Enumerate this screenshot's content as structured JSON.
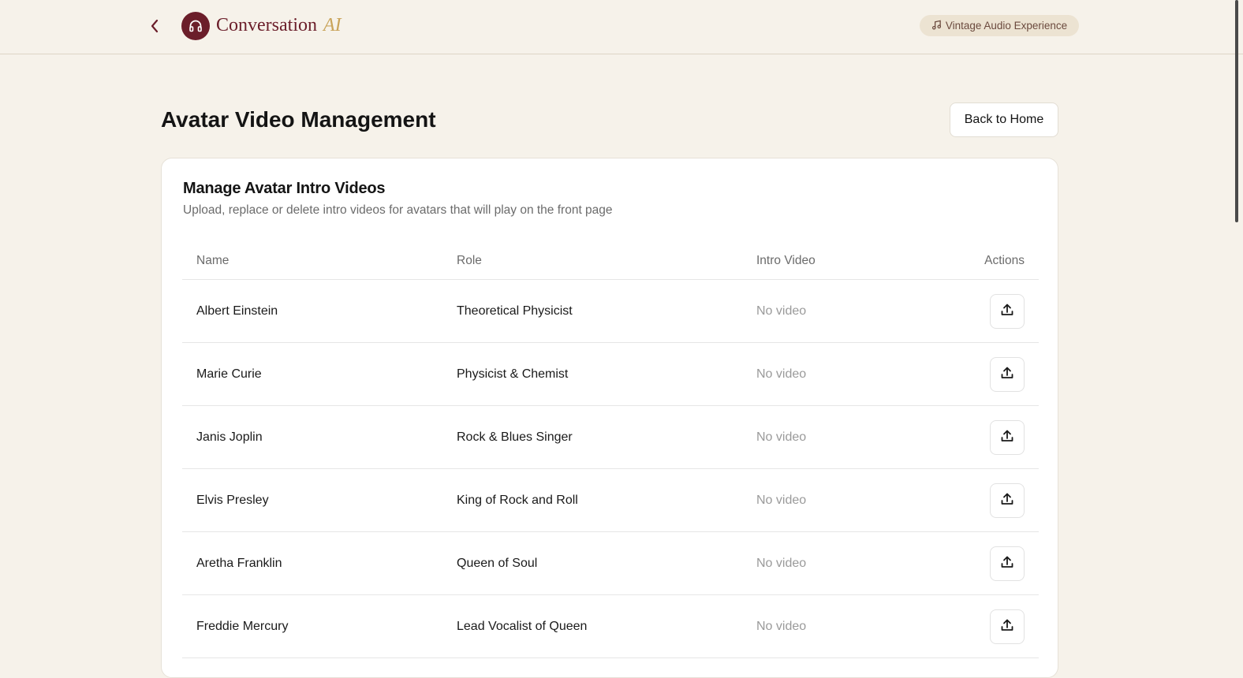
{
  "header": {
    "brand_name": "Conversation",
    "brand_ai": "AI",
    "badge_label": "Vintage Audio Experience"
  },
  "page": {
    "title": "Avatar Video Management",
    "back_home_label": "Back to Home"
  },
  "card": {
    "title": "Manage Avatar Intro Videos",
    "subtitle": "Upload, replace or delete intro videos for avatars that will play on the front page"
  },
  "table": {
    "columns": [
      "Name",
      "Role",
      "Intro Video",
      "Actions"
    ],
    "rows": [
      {
        "name": "Albert Einstein",
        "role": "Theoretical Physicist",
        "video": "No video"
      },
      {
        "name": "Marie Curie",
        "role": "Physicist & Chemist",
        "video": "No video"
      },
      {
        "name": "Janis Joplin",
        "role": "Rock & Blues Singer",
        "video": "No video"
      },
      {
        "name": "Elvis Presley",
        "role": "King of Rock and Roll",
        "video": "No video"
      },
      {
        "name": "Aretha Franklin",
        "role": "Queen of Soul",
        "video": "No video"
      },
      {
        "name": "Freddie Mercury",
        "role": "Lead Vocalist of Queen",
        "video": "No video"
      }
    ]
  },
  "colors": {
    "background": "#f6f2ea",
    "brand": "#6b1e2a",
    "accent": "#c9a45a",
    "badge_bg": "#ece3d2"
  },
  "icons": {
    "back": "chevron-left-icon",
    "logo": "headphones-icon",
    "badge": "music-note-icon",
    "upload": "upload-icon"
  }
}
